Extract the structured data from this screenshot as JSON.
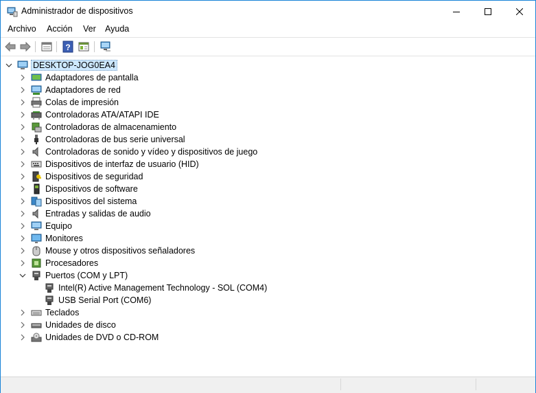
{
  "window": {
    "title": "Administrador de dispositivos",
    "minimize_icon": "minimize-icon",
    "maximize_icon": "maximize-icon",
    "close_icon": "close-icon"
  },
  "menu": {
    "items": [
      "Archivo",
      "Acción",
      "Ver",
      "Ayuda"
    ]
  },
  "toolbar": {
    "icons": [
      "back-arrow-icon",
      "forward-arrow-icon",
      "properties-pane-icon",
      "help-icon",
      "properties-icon",
      "scan-hardware-icon"
    ]
  },
  "tree": {
    "root": "DESKTOP-JOG0EA4",
    "categories": [
      {
        "label": "Adaptadores de pantalla",
        "icon": "display-adapter-icon",
        "expanded": false
      },
      {
        "label": "Adaptadores de red",
        "icon": "network-adapter-icon",
        "expanded": false
      },
      {
        "label": "Colas de impresión",
        "icon": "printer-icon",
        "expanded": false
      },
      {
        "label": "Controladoras ATA/ATAPI IDE",
        "icon": "ide-controller-icon",
        "expanded": false
      },
      {
        "label": "Controladoras de almacenamiento",
        "icon": "storage-controller-icon",
        "expanded": false
      },
      {
        "label": "Controladoras de bus serie universal",
        "icon": "usb-icon",
        "expanded": false
      },
      {
        "label": "Controladoras de sonido y vídeo y dispositivos de juego",
        "icon": "speaker-icon",
        "expanded": false
      },
      {
        "label": "Dispositivos de interfaz de usuario (HID)",
        "icon": "hid-icon",
        "expanded": false
      },
      {
        "label": "Dispositivos de seguridad",
        "icon": "security-device-icon",
        "expanded": false
      },
      {
        "label": "Dispositivos de software",
        "icon": "software-device-icon",
        "expanded": false
      },
      {
        "label": "Dispositivos del sistema",
        "icon": "system-device-icon",
        "expanded": false
      },
      {
        "label": "Entradas y salidas de audio",
        "icon": "audio-io-icon",
        "expanded": false
      },
      {
        "label": "Equipo",
        "icon": "computer-icon",
        "expanded": false
      },
      {
        "label": "Monitores",
        "icon": "monitor-icon",
        "expanded": false
      },
      {
        "label": "Mouse y otros dispositivos señaladores",
        "icon": "mouse-icon",
        "expanded": false
      },
      {
        "label": "Procesadores",
        "icon": "processor-icon",
        "expanded": false
      },
      {
        "label": "Puertos (COM y LPT)",
        "icon": "port-icon",
        "expanded": true,
        "children": [
          {
            "label": "Intel(R) Active Management Technology - SOL (COM4)",
            "icon": "port-icon"
          },
          {
            "label": "USB Serial Port (COM6)",
            "icon": "port-icon"
          }
        ]
      },
      {
        "label": "Teclados",
        "icon": "keyboard-icon",
        "expanded": false
      },
      {
        "label": "Unidades de disco",
        "icon": "disk-drive-icon",
        "expanded": false
      },
      {
        "label": "Unidades de DVD o CD-ROM",
        "icon": "dvd-drive-icon",
        "expanded": false
      }
    ]
  },
  "colors": {
    "window_border": "#1883d7",
    "selection": "#cde8ff",
    "statusbar": "#f0f0f0"
  }
}
